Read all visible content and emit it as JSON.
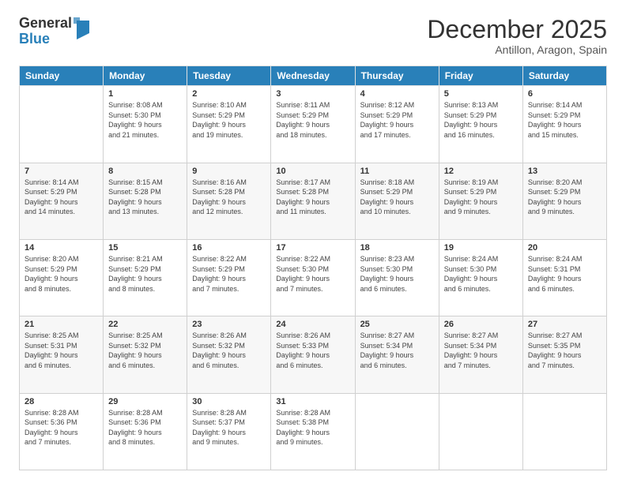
{
  "header": {
    "logo_general": "General",
    "logo_blue": "Blue",
    "title": "December 2025",
    "subtitle": "Antillon, Aragon, Spain"
  },
  "days_of_week": [
    "Sunday",
    "Monday",
    "Tuesday",
    "Wednesday",
    "Thursday",
    "Friday",
    "Saturday"
  ],
  "weeks": [
    [
      {
        "day": "",
        "info": ""
      },
      {
        "day": "1",
        "info": "Sunrise: 8:08 AM\nSunset: 5:30 PM\nDaylight: 9 hours\nand 21 minutes."
      },
      {
        "day": "2",
        "info": "Sunrise: 8:10 AM\nSunset: 5:29 PM\nDaylight: 9 hours\nand 19 minutes."
      },
      {
        "day": "3",
        "info": "Sunrise: 8:11 AM\nSunset: 5:29 PM\nDaylight: 9 hours\nand 18 minutes."
      },
      {
        "day": "4",
        "info": "Sunrise: 8:12 AM\nSunset: 5:29 PM\nDaylight: 9 hours\nand 17 minutes."
      },
      {
        "day": "5",
        "info": "Sunrise: 8:13 AM\nSunset: 5:29 PM\nDaylight: 9 hours\nand 16 minutes."
      },
      {
        "day": "6",
        "info": "Sunrise: 8:14 AM\nSunset: 5:29 PM\nDaylight: 9 hours\nand 15 minutes."
      }
    ],
    [
      {
        "day": "7",
        "info": "Sunrise: 8:14 AM\nSunset: 5:29 PM\nDaylight: 9 hours\nand 14 minutes."
      },
      {
        "day": "8",
        "info": "Sunrise: 8:15 AM\nSunset: 5:28 PM\nDaylight: 9 hours\nand 13 minutes."
      },
      {
        "day": "9",
        "info": "Sunrise: 8:16 AM\nSunset: 5:28 PM\nDaylight: 9 hours\nand 12 minutes."
      },
      {
        "day": "10",
        "info": "Sunrise: 8:17 AM\nSunset: 5:28 PM\nDaylight: 9 hours\nand 11 minutes."
      },
      {
        "day": "11",
        "info": "Sunrise: 8:18 AM\nSunset: 5:29 PM\nDaylight: 9 hours\nand 10 minutes."
      },
      {
        "day": "12",
        "info": "Sunrise: 8:19 AM\nSunset: 5:29 PM\nDaylight: 9 hours\nand 9 minutes."
      },
      {
        "day": "13",
        "info": "Sunrise: 8:20 AM\nSunset: 5:29 PM\nDaylight: 9 hours\nand 9 minutes."
      }
    ],
    [
      {
        "day": "14",
        "info": "Sunrise: 8:20 AM\nSunset: 5:29 PM\nDaylight: 9 hours\nand 8 minutes."
      },
      {
        "day": "15",
        "info": "Sunrise: 8:21 AM\nSunset: 5:29 PM\nDaylight: 9 hours\nand 8 minutes."
      },
      {
        "day": "16",
        "info": "Sunrise: 8:22 AM\nSunset: 5:29 PM\nDaylight: 9 hours\nand 7 minutes."
      },
      {
        "day": "17",
        "info": "Sunrise: 8:22 AM\nSunset: 5:30 PM\nDaylight: 9 hours\nand 7 minutes."
      },
      {
        "day": "18",
        "info": "Sunrise: 8:23 AM\nSunset: 5:30 PM\nDaylight: 9 hours\nand 6 minutes."
      },
      {
        "day": "19",
        "info": "Sunrise: 8:24 AM\nSunset: 5:30 PM\nDaylight: 9 hours\nand 6 minutes."
      },
      {
        "day": "20",
        "info": "Sunrise: 8:24 AM\nSunset: 5:31 PM\nDaylight: 9 hours\nand 6 minutes."
      }
    ],
    [
      {
        "day": "21",
        "info": "Sunrise: 8:25 AM\nSunset: 5:31 PM\nDaylight: 9 hours\nand 6 minutes."
      },
      {
        "day": "22",
        "info": "Sunrise: 8:25 AM\nSunset: 5:32 PM\nDaylight: 9 hours\nand 6 minutes."
      },
      {
        "day": "23",
        "info": "Sunrise: 8:26 AM\nSunset: 5:32 PM\nDaylight: 9 hours\nand 6 minutes."
      },
      {
        "day": "24",
        "info": "Sunrise: 8:26 AM\nSunset: 5:33 PM\nDaylight: 9 hours\nand 6 minutes."
      },
      {
        "day": "25",
        "info": "Sunrise: 8:27 AM\nSunset: 5:34 PM\nDaylight: 9 hours\nand 6 minutes."
      },
      {
        "day": "26",
        "info": "Sunrise: 8:27 AM\nSunset: 5:34 PM\nDaylight: 9 hours\nand 7 minutes."
      },
      {
        "day": "27",
        "info": "Sunrise: 8:27 AM\nSunset: 5:35 PM\nDaylight: 9 hours\nand 7 minutes."
      }
    ],
    [
      {
        "day": "28",
        "info": "Sunrise: 8:28 AM\nSunset: 5:36 PM\nDaylight: 9 hours\nand 7 minutes."
      },
      {
        "day": "29",
        "info": "Sunrise: 8:28 AM\nSunset: 5:36 PM\nDaylight: 9 hours\nand 8 minutes."
      },
      {
        "day": "30",
        "info": "Sunrise: 8:28 AM\nSunset: 5:37 PM\nDaylight: 9 hours\nand 9 minutes."
      },
      {
        "day": "31",
        "info": "Sunrise: 8:28 AM\nSunset: 5:38 PM\nDaylight: 9 hours\nand 9 minutes."
      },
      {
        "day": "",
        "info": ""
      },
      {
        "day": "",
        "info": ""
      },
      {
        "day": "",
        "info": ""
      }
    ]
  ]
}
